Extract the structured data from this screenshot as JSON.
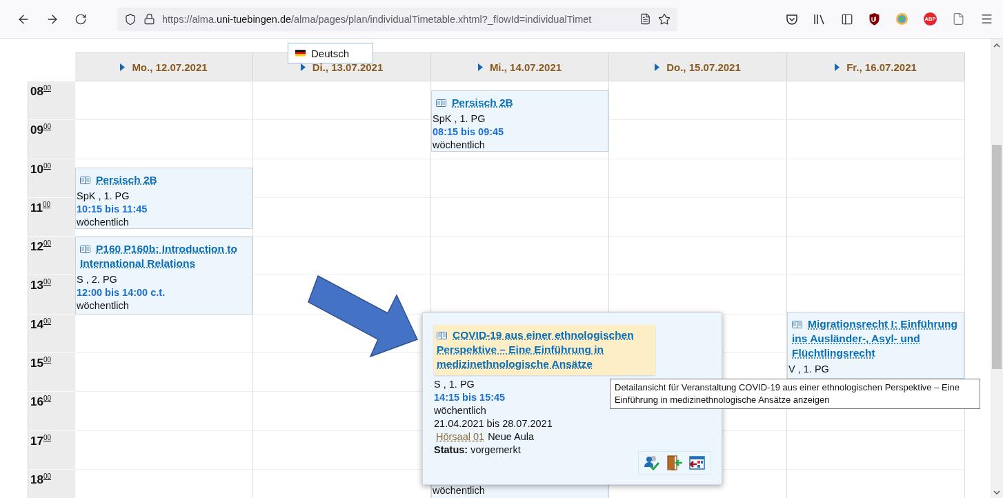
{
  "browser": {
    "url": [
      {
        "text": "https://alma.",
        "emphasis": false
      },
      {
        "text": "uni-tuebingen.de",
        "emphasis": true
      },
      {
        "text": "/alma/pages/plan/individualTimetable.xhtml?_flowId=individualTimet",
        "emphasis": false
      }
    ],
    "abp_label": "ABP"
  },
  "language_menu": {
    "label": "Deutsch"
  },
  "timetable": {
    "days": [
      {
        "label": "Mo., 12.07.2021",
        "events": [
          {
            "kind": "full",
            "title": "Persisch 2B",
            "type": "SpK , 1. PG",
            "time": "10:15 bis 11:45",
            "recurrence": "wöchentlich"
          },
          {
            "kind": "full",
            "title": "P160 P160b: Introduction to International Relations",
            "type": "S , 2. PG",
            "time": "12:00 bis 14:00 c.t.",
            "recurrence": "wöchentlich"
          }
        ]
      },
      {
        "label": "Di., 13.07.2021"
      },
      {
        "label": "Mi., 14.07.2021",
        "events": [
          {
            "kind": "full",
            "title": "Persisch 2B",
            "type": "SpK , 1. PG",
            "time": "08:15 bis 09:45",
            "recurrence": "wöchentlich"
          },
          {
            "kind": "covered",
            "recurrence": "wöchentlich"
          }
        ]
      },
      {
        "label": "Do., 15.07.2021"
      },
      {
        "label": "Fr., 16.07.2021",
        "events": [
          {
            "kind": "full",
            "title": "Migrationsrecht I: Einführung ins Ausländer-, Asyl- und Flüchtlingsrecht",
            "type": "V , 1. PG"
          }
        ]
      }
    ],
    "hours": [
      {
        "hour": "08",
        "minutes": "00"
      },
      {
        "hour": "09",
        "minutes": "00"
      },
      {
        "hour": "10",
        "minutes": "00"
      },
      {
        "hour": "11",
        "minutes": "00"
      },
      {
        "hour": "12",
        "minutes": "00"
      },
      {
        "hour": "13",
        "minutes": "00"
      },
      {
        "hour": "14",
        "minutes": "00"
      },
      {
        "hour": "15",
        "minutes": "00"
      },
      {
        "hour": "16",
        "minutes": "00"
      },
      {
        "hour": "17",
        "minutes": "00"
      },
      {
        "hour": "18",
        "minutes": "00"
      }
    ]
  },
  "popup": {
    "title": "COVID-19 aus einer ethnologischen Perspektive – Eine Einführung in medizinethnologische Ansätze",
    "type": "S , 1. PG",
    "time": "14:15 bis 15:45",
    "recurrence": "wöchentlich",
    "dates": "21.04.2021 bis 28.07.2021",
    "room": "Hörsaal 01",
    "building": "Neue Aula",
    "status": "**Status:** vorgemerkt"
  },
  "tooltip": {
    "text": "Detailansicht für Veranstaltung COVID-19 aus einer ethnologischen Perspektive – Eine Einführung in medizinethnologische Ansätze anzeigen"
  }
}
